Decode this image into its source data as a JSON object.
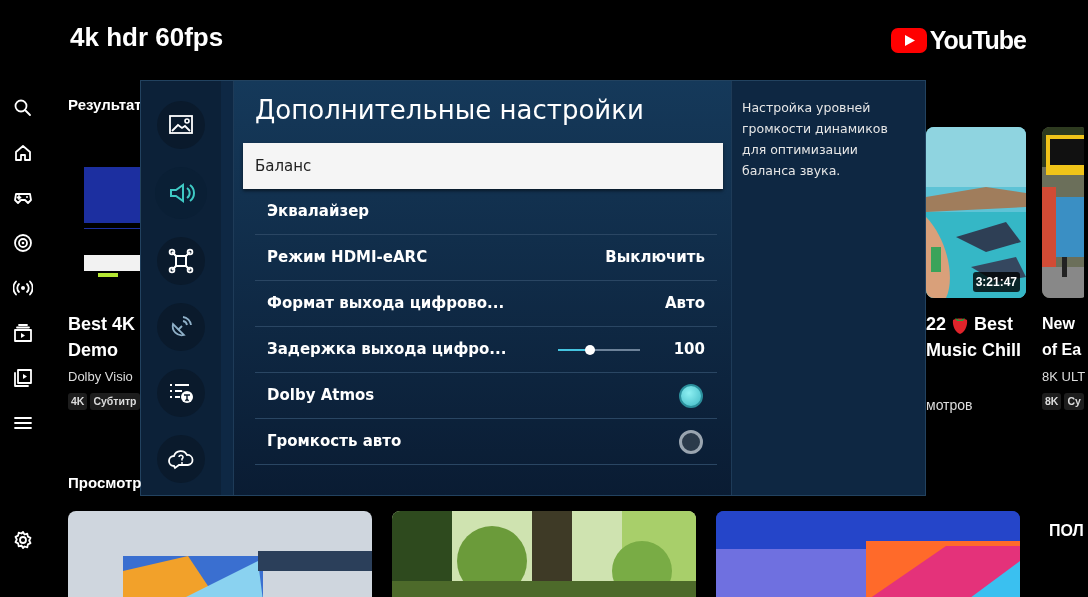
{
  "header": {
    "search_query": "4k hdr 60fps",
    "logo_text": "YouTube"
  },
  "results_heading": "Результат",
  "videos": [
    {
      "title_lines": [
        [
          "Best 4K"
        ],
        [
          "Demo"
        ]
      ],
      "channel": "Dolby Visio",
      "tags": [
        "4K",
        "Субтитр"
      ]
    },
    {
      "duration": "3:21:47",
      "title_lines": [
        [
          "22",
          "Best"
        ],
        [
          "Music Chill"
        ]
      ],
      "views": "мотров"
    },
    {
      "title_lines": [
        [
          "New"
        ],
        [
          "of Ea"
        ]
      ],
      "channel": "8K ULT",
      "tags": [
        "8K",
        "Су"
      ]
    }
  ],
  "second_heading": "Просмотр",
  "second_row_edge_text": "ПОЛ",
  "settings": {
    "title": "Дополнительные настройки",
    "description": "Настройка уровней громкости динамиков для оптимизации баланса звука.",
    "categories": [
      {
        "selected": false
      },
      {
        "selected": true
      },
      {
        "selected": false
      },
      {
        "selected": false
      },
      {
        "selected": false
      },
      {
        "selected": false
      }
    ],
    "rows": [
      {
        "kind": "plain",
        "label": "Баланс",
        "selected": true
      },
      {
        "kind": "plain",
        "label": "Эквалайзер",
        "selected": false
      },
      {
        "kind": "value",
        "label": "Режим HDMI-eARC",
        "value": "Выключить",
        "selected": false
      },
      {
        "kind": "value",
        "label": "Формат выхода цифрово...",
        "value": "Авто",
        "selected": false
      },
      {
        "kind": "slider",
        "label": "Задержка выхода цифро...",
        "level": 0.39,
        "value": "100",
        "selected": false
      },
      {
        "kind": "toggle",
        "label": "Dolby Atmos",
        "on": true,
        "selected": false
      },
      {
        "kind": "toggle",
        "label": "Громкость авто",
        "on": false,
        "selected": false
      }
    ]
  }
}
